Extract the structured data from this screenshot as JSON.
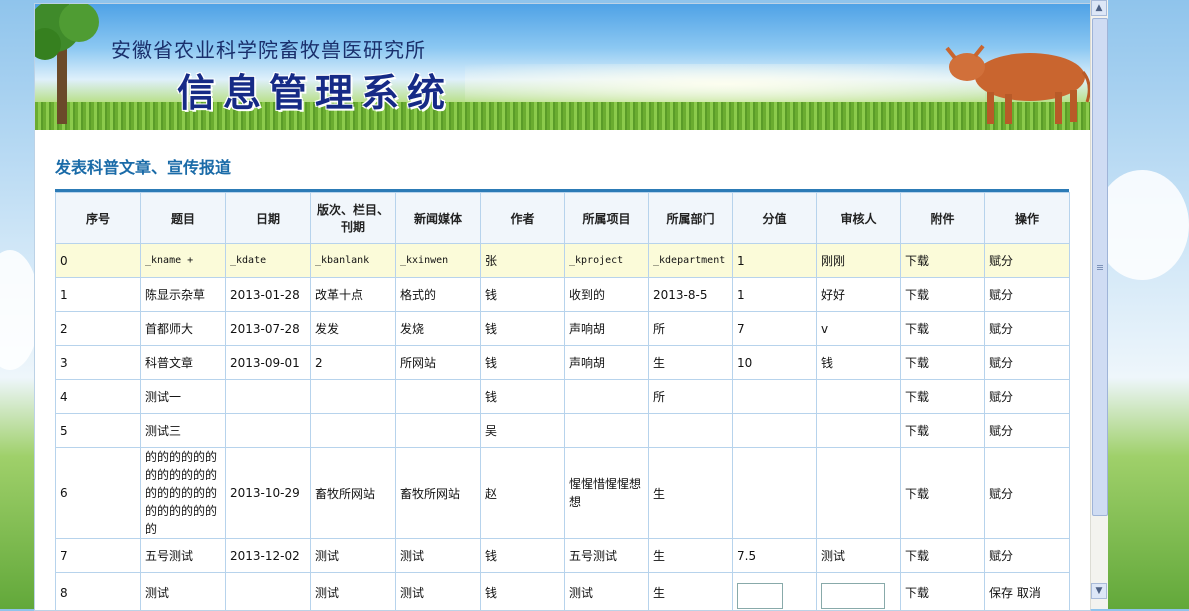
{
  "header": {
    "subtitle": "安徽省农业科学院畜牧兽医研究所",
    "title": "信息管理系统"
  },
  "section_title": "发表科普文章、宣传报道",
  "table": {
    "columns": [
      "序号",
      "题目",
      "日期",
      "版次、栏目、刊期",
      "新闻媒体",
      "作者",
      "所属项目",
      "所属部门",
      "分值",
      "审核人",
      "附件",
      "操作"
    ],
    "rows": [
      {
        "no": "0",
        "title": "_kname +",
        "date": "_kdate",
        "edition": "_kbanlank",
        "media": "_kxinwen",
        "author": "张",
        "project": "_kproject",
        "dept": "_kdepartment",
        "score": "1",
        "reviewer": "刚刚",
        "attach": "下载",
        "op": "赋分"
      },
      {
        "no": "1",
        "title": "陈显示杂草",
        "date": "2013-01-28",
        "edition": "改革十点",
        "media": "格式的",
        "author": "钱",
        "project": "收到的",
        "dept": "2013-8-5",
        "score": "1",
        "reviewer": "好好",
        "attach": "下载",
        "op": "赋分"
      },
      {
        "no": "2",
        "title": "首都师大",
        "date": "2013-07-28",
        "edition": "发发",
        "media": "发烧",
        "author": "钱",
        "project": "声响胡",
        "dept": "所",
        "score": "7",
        "reviewer": "v",
        "attach": "下载",
        "op": "赋分"
      },
      {
        "no": "3",
        "title": "科普文章",
        "date": "2013-09-01",
        "edition": "2",
        "media": "所网站",
        "author": "钱",
        "project": "声响胡",
        "dept": "生",
        "score": "10",
        "reviewer": "钱",
        "attach": "下载",
        "op": "赋分"
      },
      {
        "no": "4",
        "title": "测试一",
        "date": "",
        "edition": "",
        "media": "",
        "author": "钱",
        "project": "",
        "dept": "所",
        "score": "",
        "reviewer": "",
        "attach": "下载",
        "op": "赋分"
      },
      {
        "no": "5",
        "title": "测试三",
        "date": "",
        "edition": "",
        "media": "",
        "author": "吴",
        "project": "",
        "dept": "",
        "score": "",
        "reviewer": "",
        "attach": "下载",
        "op": "赋分"
      },
      {
        "no": "6",
        "title": "的的的的的的的的的的的的的的的的的的的的的的的的的",
        "date": "2013-10-29",
        "edition": "畜牧所网站",
        "media": "畜牧所网站",
        "author": "赵",
        "project": "惺惺惜惺惺想想",
        "dept": "生",
        "score": "",
        "reviewer": "",
        "attach": "下载",
        "op": "赋分"
      },
      {
        "no": "7",
        "title": "五号测试",
        "date": "2013-12-02",
        "edition": "测试",
        "media": "测试",
        "author": "钱",
        "project": "五号测试",
        "dept": "生",
        "score": "7.5",
        "reviewer": "测试",
        "attach": "下载",
        "op": "赋分"
      }
    ],
    "edit_row": {
      "no": "8",
      "title": "测试",
      "date": "",
      "edition": "测试",
      "media": "测试",
      "author": "钱",
      "project": "测试",
      "dept": "生",
      "score_value": "",
      "reviewer_value": "",
      "attach": "下载",
      "save": "保存",
      "cancel": "取消"
    }
  }
}
